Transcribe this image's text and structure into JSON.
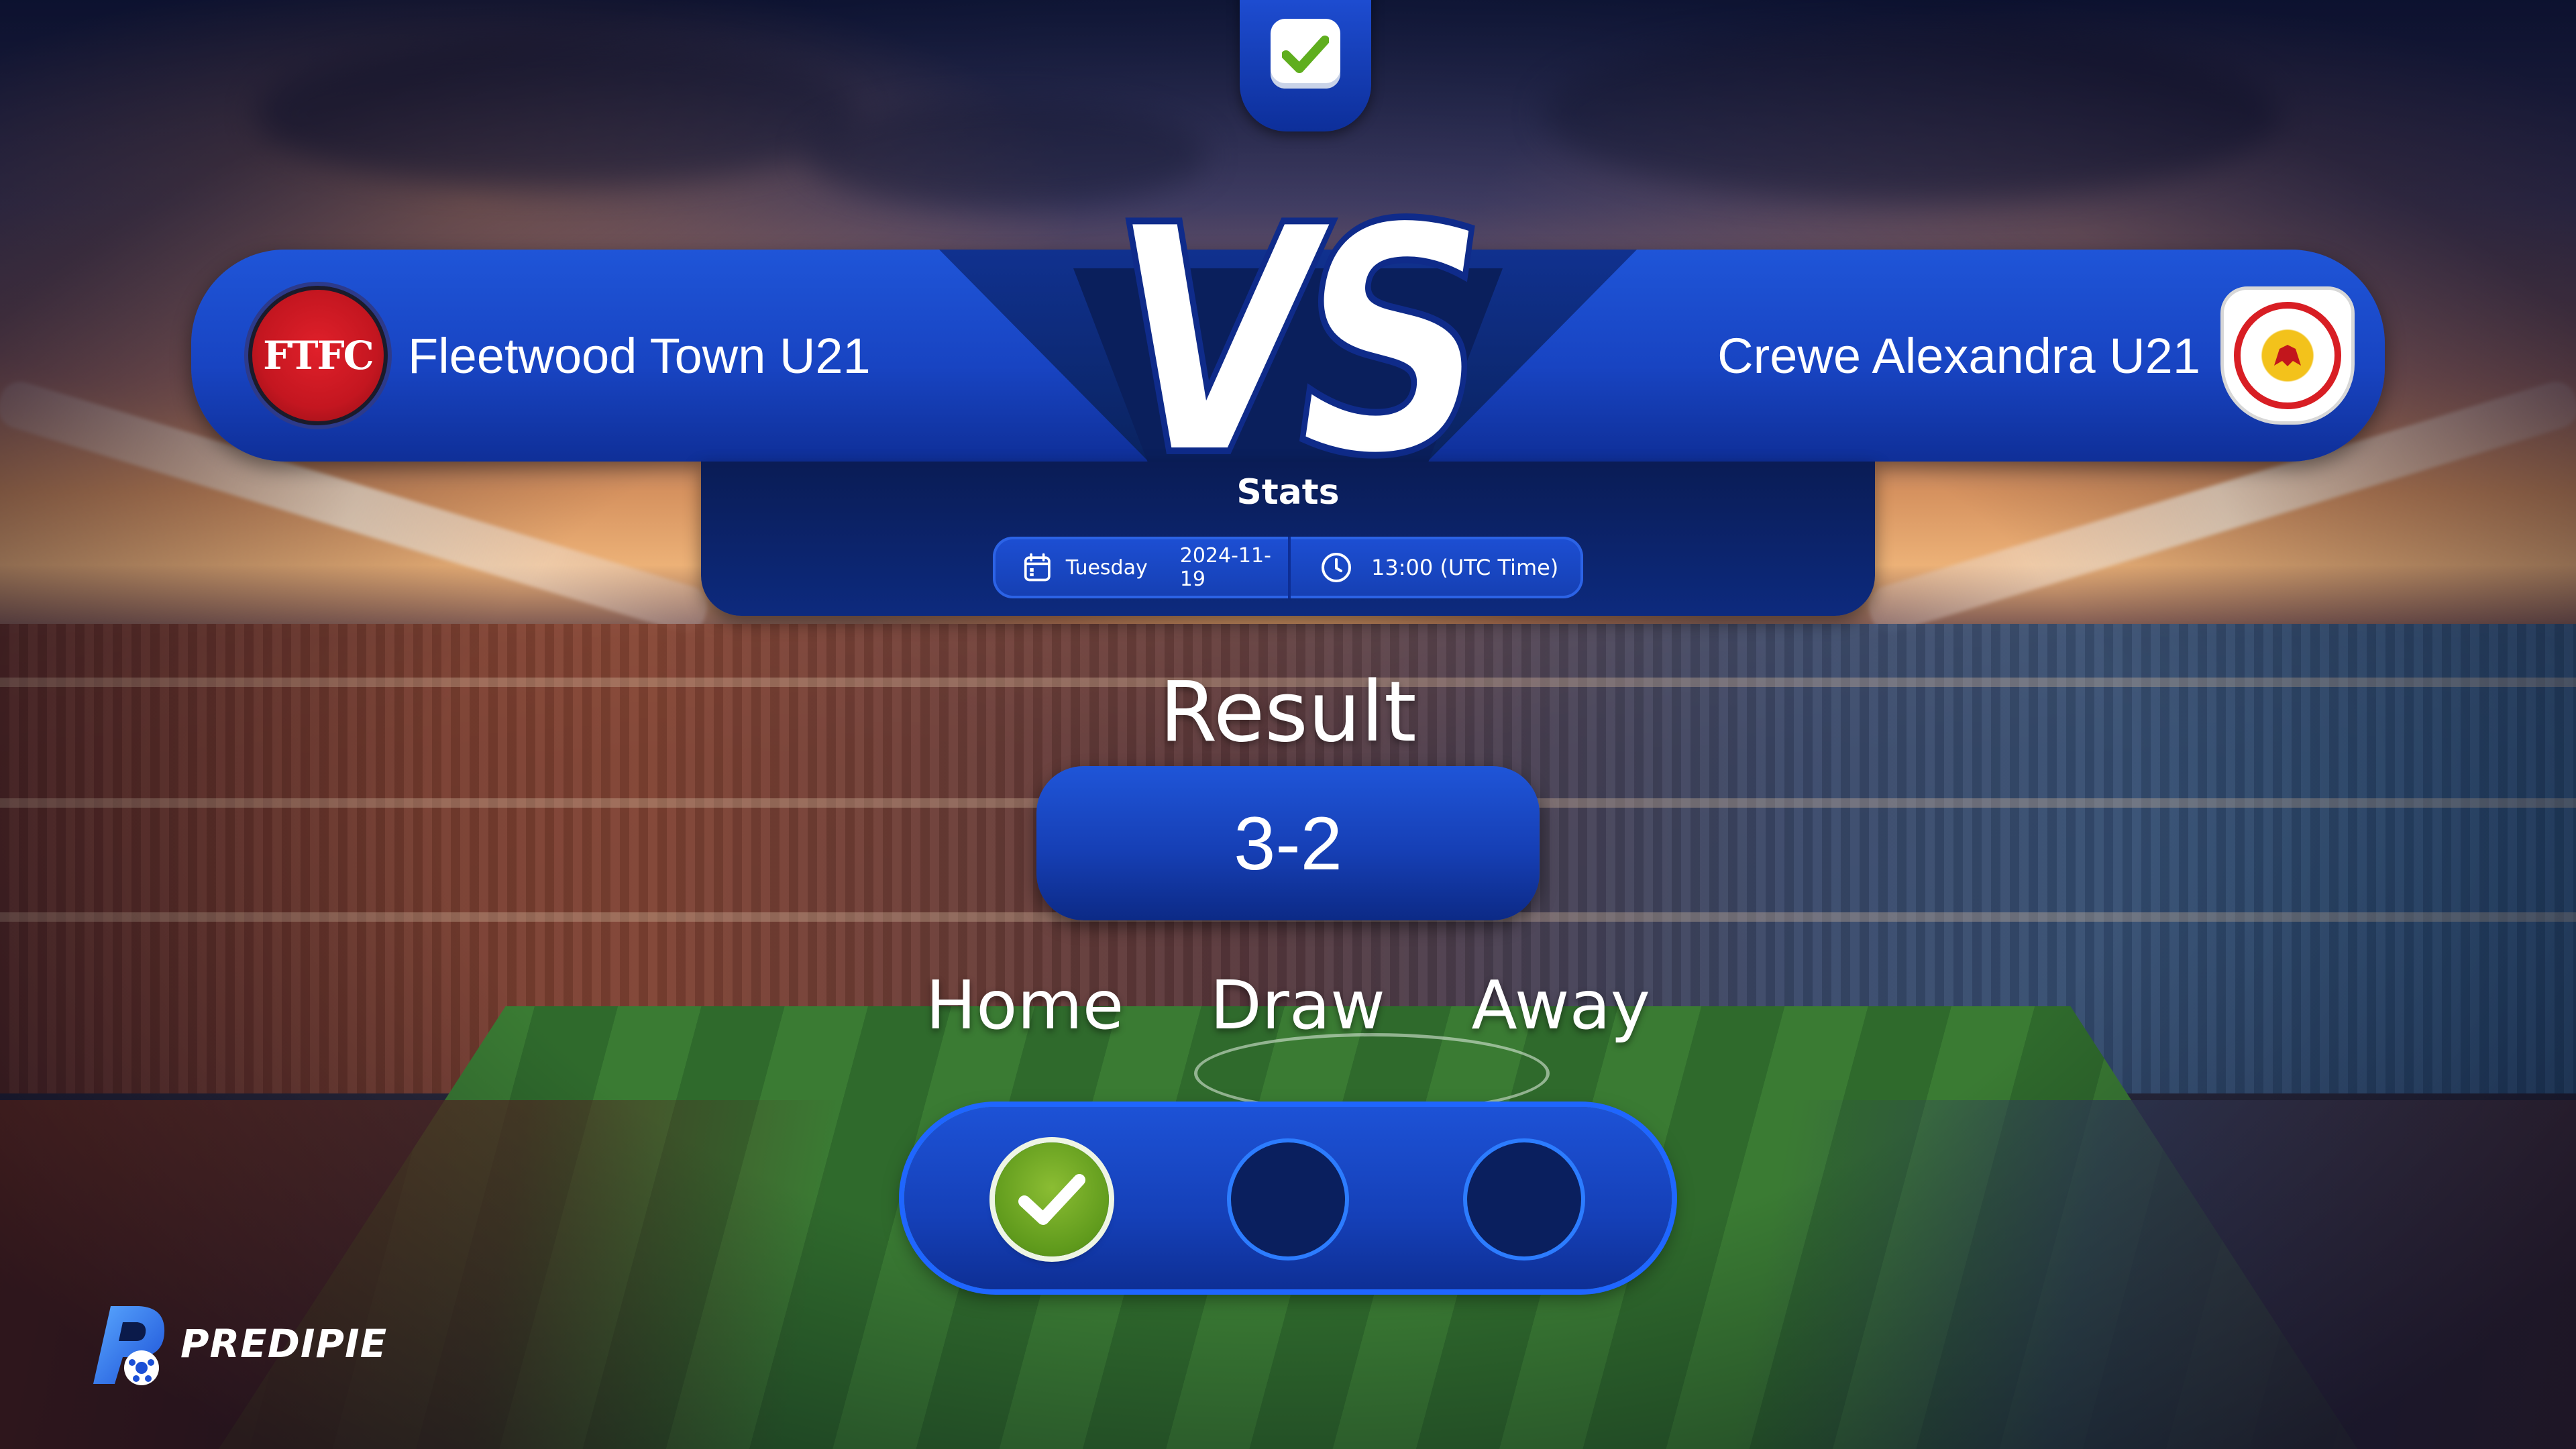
{
  "top_badge": {
    "icon": "check-icon"
  },
  "match": {
    "home_team": {
      "name": "Fleetwood Town U21",
      "crest_text": "FTFC"
    },
    "away_team": {
      "name": "Crewe Alexandra U21"
    },
    "vs_label": "VS"
  },
  "stats": {
    "title": "Stats",
    "day": "Tuesday",
    "date": "2024-11-19",
    "time": "13:00 (UTC Time)",
    "icons": {
      "date": "calendar-icon",
      "time": "clock-icon"
    }
  },
  "result": {
    "label": "Result",
    "score": "3-2"
  },
  "outcome": {
    "labels": {
      "home": "Home",
      "draw": "Draw",
      "away": "Away"
    },
    "selected": "home"
  },
  "brand": {
    "name": "PREDIPIE"
  },
  "colors": {
    "primary_blue": "#1844c2",
    "dark_navy": "#0a1f5c",
    "selected_green": "#6aa823",
    "text": "#ffffff"
  }
}
